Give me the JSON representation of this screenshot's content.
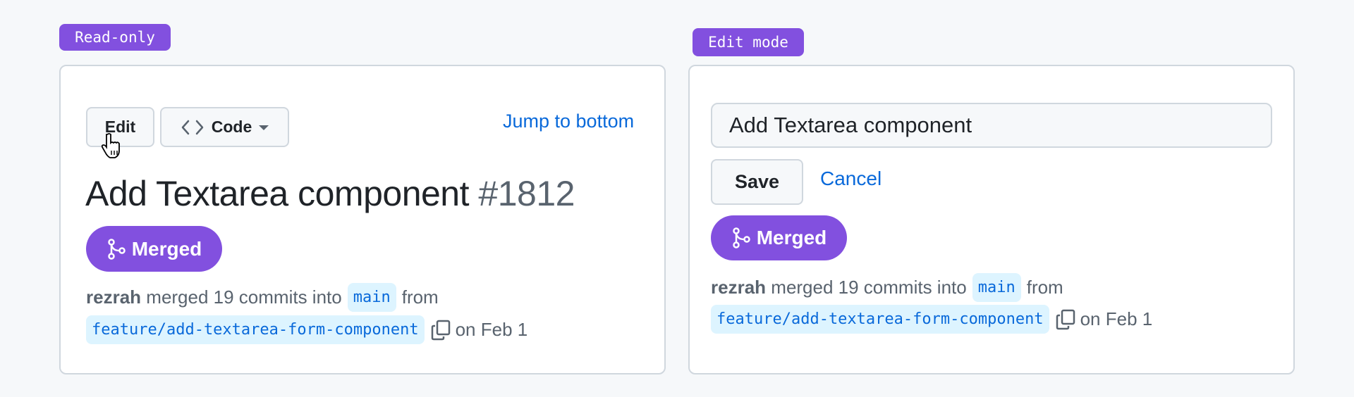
{
  "colors": {
    "accent": "#8250df",
    "link": "#0969da",
    "code_bg": "#ddf4ff",
    "border": "#d0d7de",
    "bg": "#f6f8fa"
  },
  "left": {
    "badge": "Read-only",
    "edit_label": "Edit",
    "code_label": "Code",
    "code_icon": "code-icon",
    "jump_label": "Jump to bottom",
    "title": "Add Textarea component",
    "number": "#1812",
    "status": "Merged",
    "status_icon": "git-merge-icon",
    "author": "rezrah",
    "action": "merged 19 commits into",
    "base_branch": "main",
    "from": "from",
    "head_branch": "feature/add-textarea-form-component",
    "copy_icon": "copy-icon",
    "date": "on Feb 1"
  },
  "right": {
    "badge": "Edit mode",
    "title_value": "Add Textarea component",
    "save_label": "Save",
    "cancel_label": "Cancel",
    "status": "Merged",
    "author": "rezrah",
    "action": "merged 19 commits into",
    "base_branch": "main",
    "from": "from",
    "head_branch": "feature/add-textarea-form-component",
    "date": "on Feb 1"
  }
}
